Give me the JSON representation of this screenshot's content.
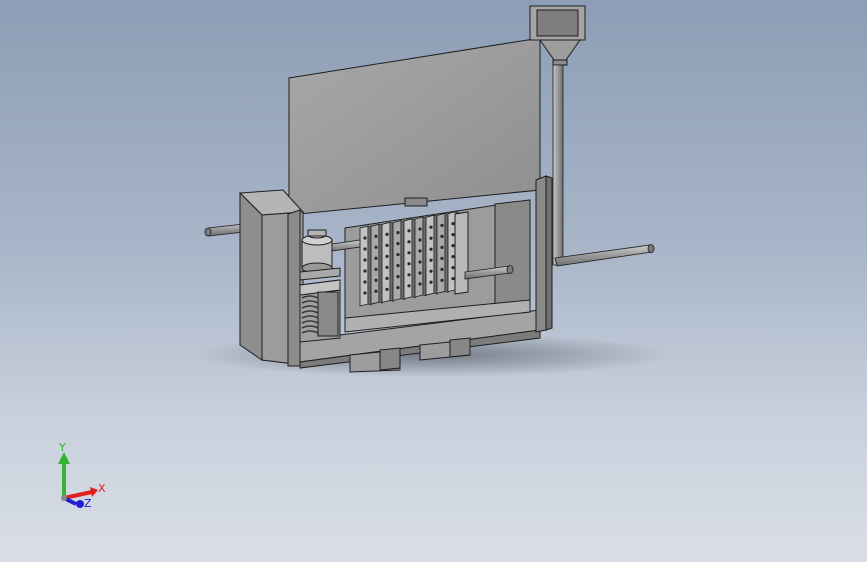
{
  "viewport": {
    "background_top": "#8c9db5",
    "background_bottom": "#d9dee6"
  },
  "model": {
    "body_color": "#9a9a9a",
    "edge_color": "#1e1e1e"
  },
  "triad": {
    "axes": [
      {
        "label": "Y",
        "color": "#2fb52f"
      },
      {
        "label": "X",
        "color": "#e02020"
      },
      {
        "label": "Z",
        "color": "#2020d0"
      }
    ]
  }
}
